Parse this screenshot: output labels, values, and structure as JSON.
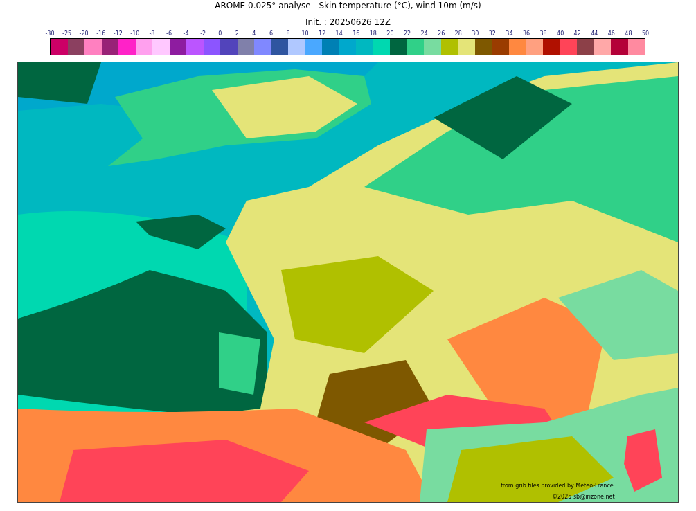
{
  "title": "AROME 0.025° analyse - Skin temperature (°C), wind 10m (m/s)",
  "subtitle": "Init. : 20250626 12Z",
  "colorbar": {
    "ticks": [
      "-30",
      "-25",
      "-20",
      "-16",
      "-12",
      "-10",
      "-8",
      "-6",
      "-4",
      "-2",
      "0",
      "2",
      "4",
      "6",
      "8",
      "10",
      "12",
      "14",
      "16",
      "18",
      "20",
      "22",
      "24",
      "26",
      "28",
      "30",
      "32",
      "34",
      "36",
      "38",
      "40",
      "42",
      "44",
      "46",
      "48",
      "50"
    ],
    "bins": [
      {
        "color": "#cc0066"
      },
      {
        "color": "#8b4060"
      },
      {
        "color": "#ff80c0"
      },
      {
        "color": "#992277"
      },
      {
        "color": "#ff22c8"
      },
      {
        "color": "#ffa0ee"
      },
      {
        "color": "#ffc8ff"
      },
      {
        "color": "#8e1ca0"
      },
      {
        "color": "#bb55ff"
      },
      {
        "color": "#8c55ff"
      },
      {
        "color": "#5244bb"
      },
      {
        "color": "#8080aa"
      },
      {
        "color": "#8088ff"
      },
      {
        "color": "#2f55a0"
      },
      {
        "color": "#b0c8ff"
      },
      {
        "color": "#4aa8ff"
      },
      {
        "color": "#0080b4"
      },
      {
        "color": "#00a8cc"
      },
      {
        "color": "#00b8c0"
      },
      {
        "color": "#00d8b0"
      },
      {
        "color": "#006640"
      },
      {
        "color": "#30d088"
      },
      {
        "color": "#78dca0"
      },
      {
        "color": "#b0c000"
      },
      {
        "color": "#e4e478"
      },
      {
        "color": "#7e5800"
      },
      {
        "color": "#9a3c00"
      },
      {
        "color": "#ff8840"
      },
      {
        "color": "#ffa080"
      },
      {
        "color": "#b01000"
      },
      {
        "color": "#ff4458"
      },
      {
        "color": "#8c4048"
      },
      {
        "color": "#ffa8a8"
      },
      {
        "color": "#b40038"
      },
      {
        "color": "#ff8aa0"
      }
    ]
  },
  "credits": [
    "from grib files provided by Meteo-France",
    "©2025 sb@irizone.net"
  ]
}
